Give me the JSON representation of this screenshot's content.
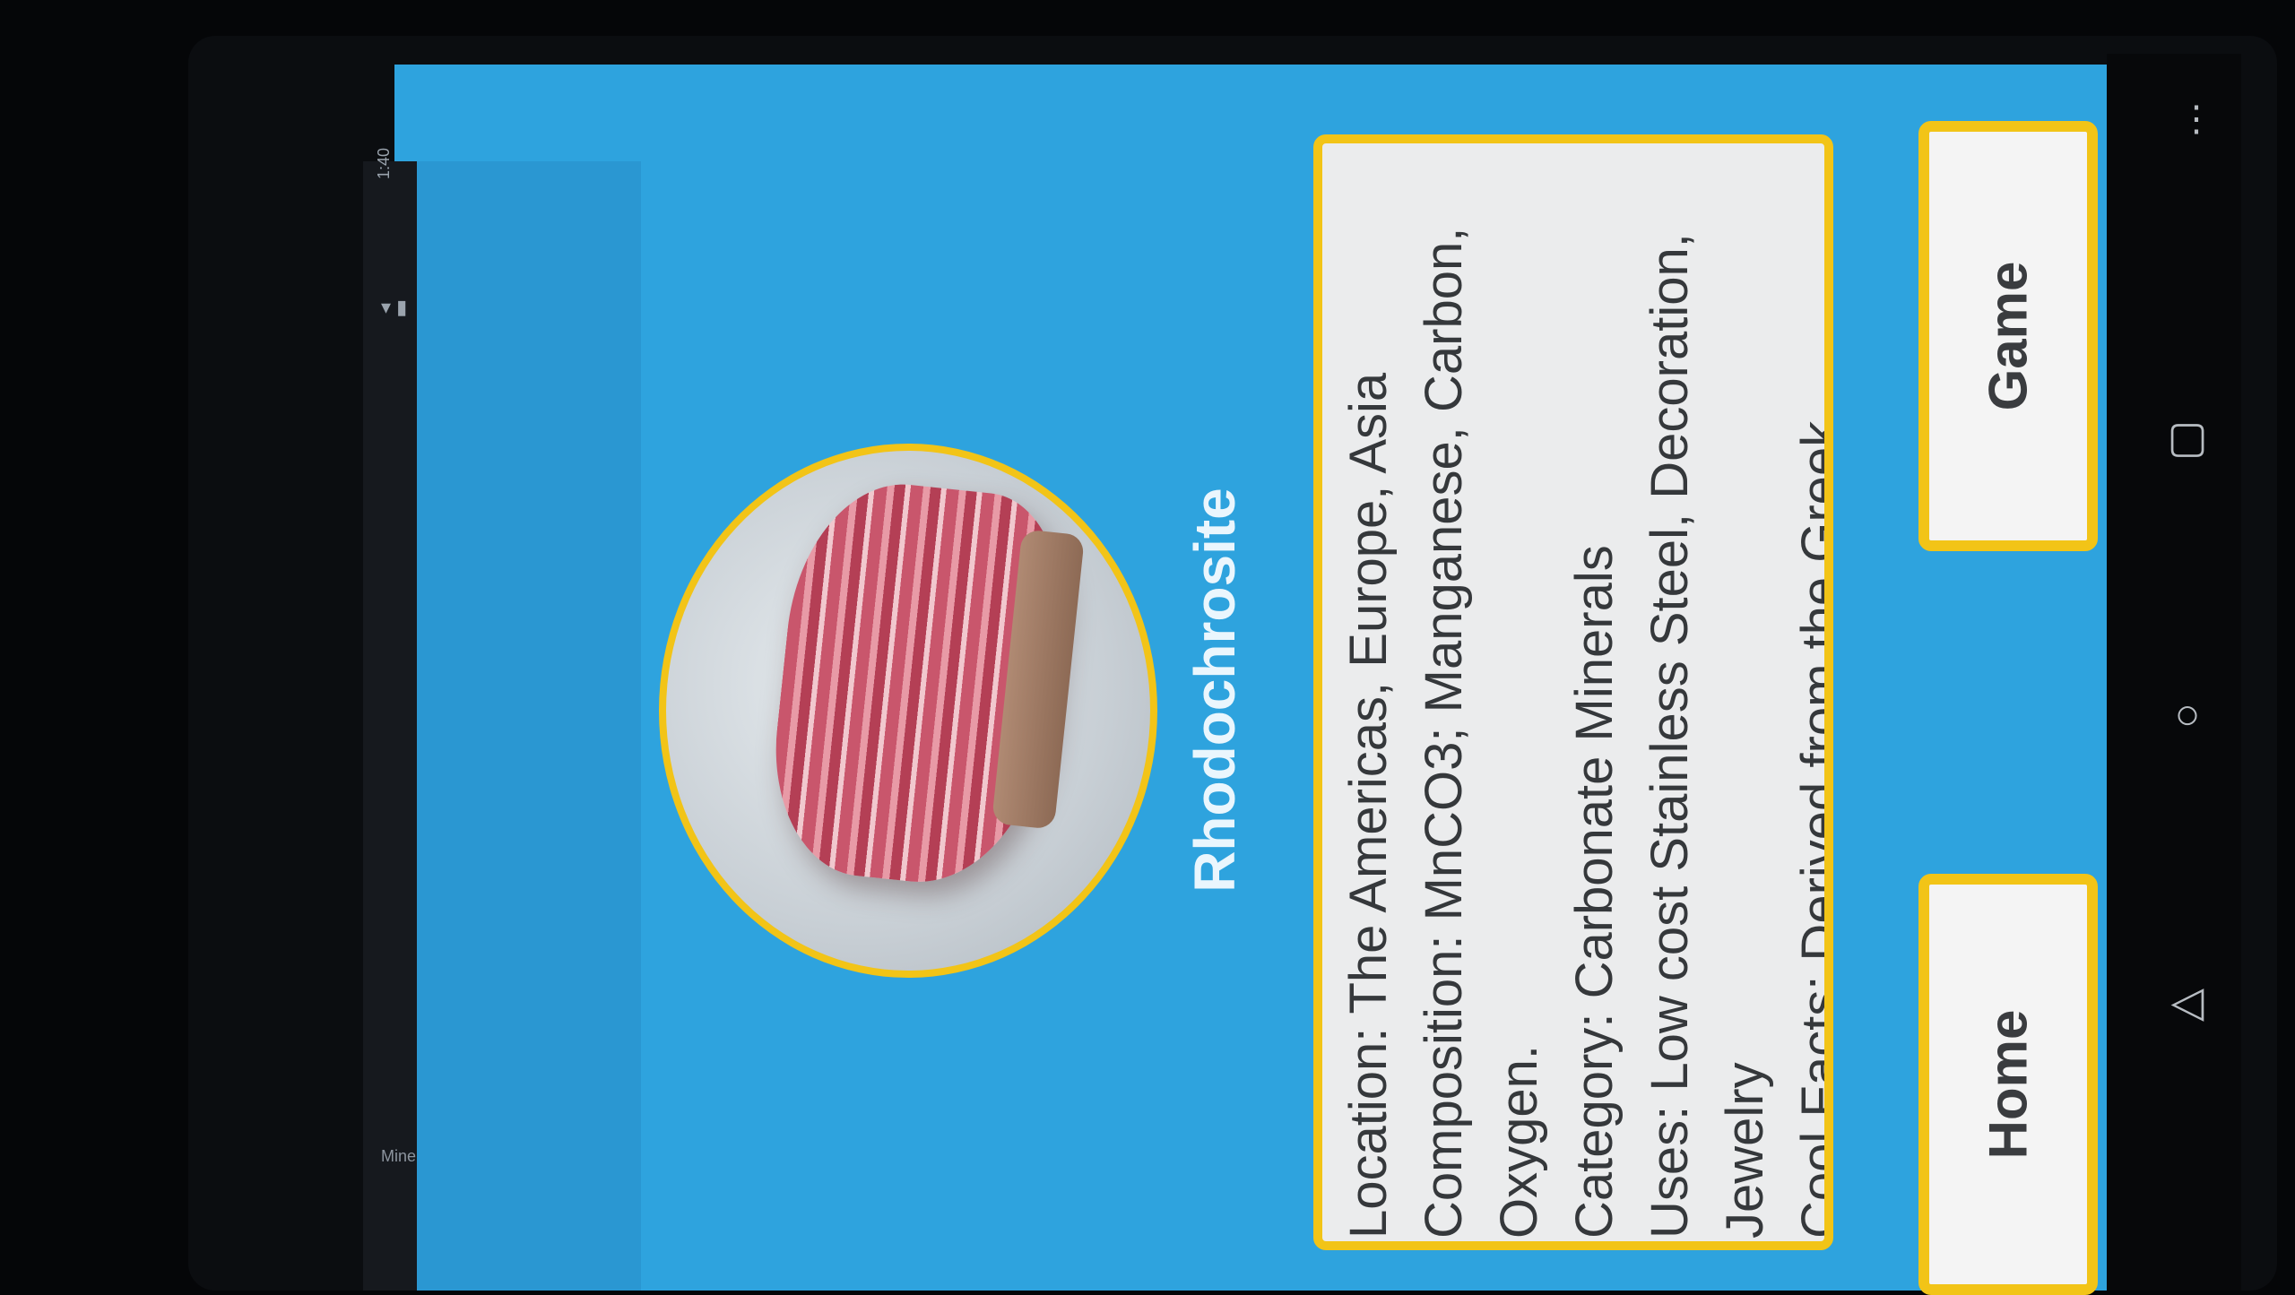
{
  "status_bar": {
    "time": "1:40",
    "icons": "▾ ▮",
    "app": "Mineral"
  },
  "mineral": {
    "name": "Rhodochrosite",
    "info": [
      "Location: The Americas, Europe, Asia",
      "Composition: MnCO3; Manganese, Carbon, Oxygen.",
      "Category: Carbonate Minerals",
      "Uses: Low cost Stainless Steel, Decoration, Jewelry",
      "Cool Facts: Derived from the Greek"
    ]
  },
  "buttons": {
    "game": "Game",
    "home": "Home"
  },
  "nav": {
    "recents": "▢",
    "home": "○",
    "back": "◁",
    "menu": "⋮"
  },
  "colors": {
    "background": "#2ea3de",
    "accent": "#f2c417"
  }
}
